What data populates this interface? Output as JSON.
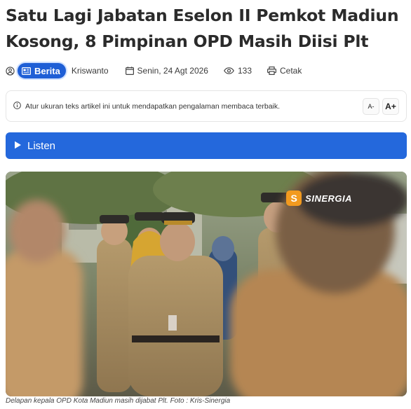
{
  "article": {
    "title": "Satu Lagi Jabatan Eselon II Pemkot Madiun Kosong, 8 Pimpinan OPD Masih Diisi Plt",
    "category": "Berita",
    "author": "Kriswanto",
    "date": "Senin, 24 Agt 2026",
    "views": "133",
    "print_label": "Cetak"
  },
  "icons": {
    "user": "user-circle-icon",
    "category": "newspaper-icon",
    "date": "calendar-icon",
    "views": "eye-icon",
    "print": "printer-icon",
    "info": "info-icon",
    "play": "play-icon"
  },
  "notice": {
    "text": "Atur ukuran teks artikel ini untuk mendapatkan pengalaman membaca terbaik.",
    "decrease_label": "A-",
    "increase_label": "A+"
  },
  "listen": {
    "label": "Listen"
  },
  "photo": {
    "watermark_mark": "S",
    "watermark_text": "SINERGIA",
    "caption": "Delapan kepala OPD Kota Madiun masih dijabat Plt. Foto : Kris-Sinergia"
  },
  "colors": {
    "accent": "#2468dc",
    "badge": "#1f5fd6",
    "watermark": "#f29a1f"
  }
}
